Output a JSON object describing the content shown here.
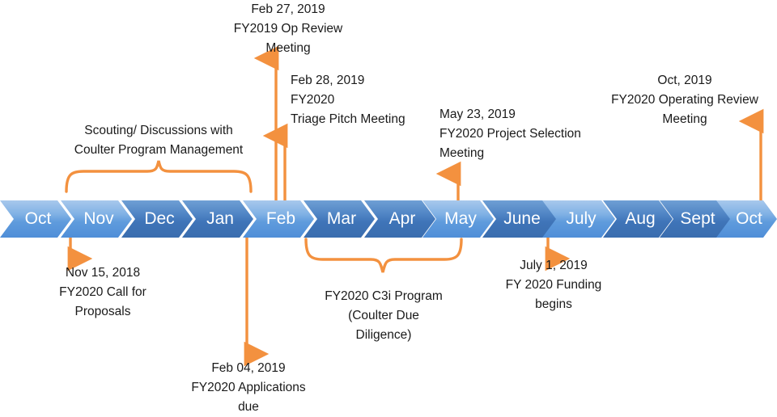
{
  "theme": {
    "accent": "#f3913f",
    "chevron_light": "#7fb0e4",
    "chevron_dark": "#4f84c4",
    "text": "#1a1a1a",
    "background": "#ffffff"
  },
  "timeline": {
    "months": [
      {
        "label": "Oct",
        "tone": "light"
      },
      {
        "label": "Nov",
        "tone": "light"
      },
      {
        "label": "Dec",
        "tone": "dark"
      },
      {
        "label": "Jan",
        "tone": "dark"
      },
      {
        "label": "Feb",
        "tone": "light"
      },
      {
        "label": "Mar",
        "tone": "dark"
      },
      {
        "label": "Apr",
        "tone": "dark"
      },
      {
        "label": "May",
        "tone": "light"
      },
      {
        "label": "June",
        "tone": "dark"
      },
      {
        "label": "July",
        "tone": "light"
      },
      {
        "label": "Aug",
        "tone": "dark"
      },
      {
        "label": "Sept",
        "tone": "dark"
      },
      {
        "label": "Oct",
        "tone": "light"
      }
    ]
  },
  "annotations": {
    "feb27": {
      "date": "Feb 27, 2019",
      "line2": "FY2019 Op Review",
      "line3": "Meeting",
      "text": "Feb 27, 2019\nFY2019 Op Review\nMeeting"
    },
    "feb28": {
      "date": "Feb 28, 2019",
      "line2": "FY2020",
      "line3": "Triage Pitch Meeting",
      "text": "Feb 28, 2019\nFY2020\nTriage Pitch Meeting"
    },
    "may23": {
      "date": "May 23, 2019",
      "line2": "FY2020 Project Selection",
      "line3": "Meeting",
      "text": "May 23, 2019\nFY2020 Project Selection\nMeeting"
    },
    "oct2019": {
      "date": "Oct, 2019",
      "line2": "FY2020 Operating Review",
      "line3": "Meeting",
      "text": "Oct, 2019\nFY2020 Operating Review\nMeeting"
    },
    "scouting": {
      "line1": "Scouting/ Discussions with",
      "line2": "Coulter Program Management",
      "text": "Scouting/ Discussions with\nCoulter Program Management"
    },
    "nov15": {
      "date": "Nov 15, 2018",
      "line2": "FY2020 Call for",
      "line3": "Proposals",
      "text": "Nov 15, 2018\nFY2020 Call for\nProposals"
    },
    "feb04": {
      "date": "Feb 04, 2019",
      "line2": "FY2020 Applications",
      "line3": "due",
      "text": "Feb 04, 2019\nFY2020 Applications\ndue"
    },
    "c3i": {
      "line1": "FY2020 C3i Program",
      "line2": "(Coulter Due",
      "line3": "Diligence)",
      "text": "FY2020 C3i Program\n(Coulter Due\nDiligence)"
    },
    "july1": {
      "date": "July 1, 2019",
      "line2": "FY 2020 Funding",
      "line3": "begins",
      "text": "July 1, 2019\nFY 2020 Funding\nbegins"
    }
  }
}
